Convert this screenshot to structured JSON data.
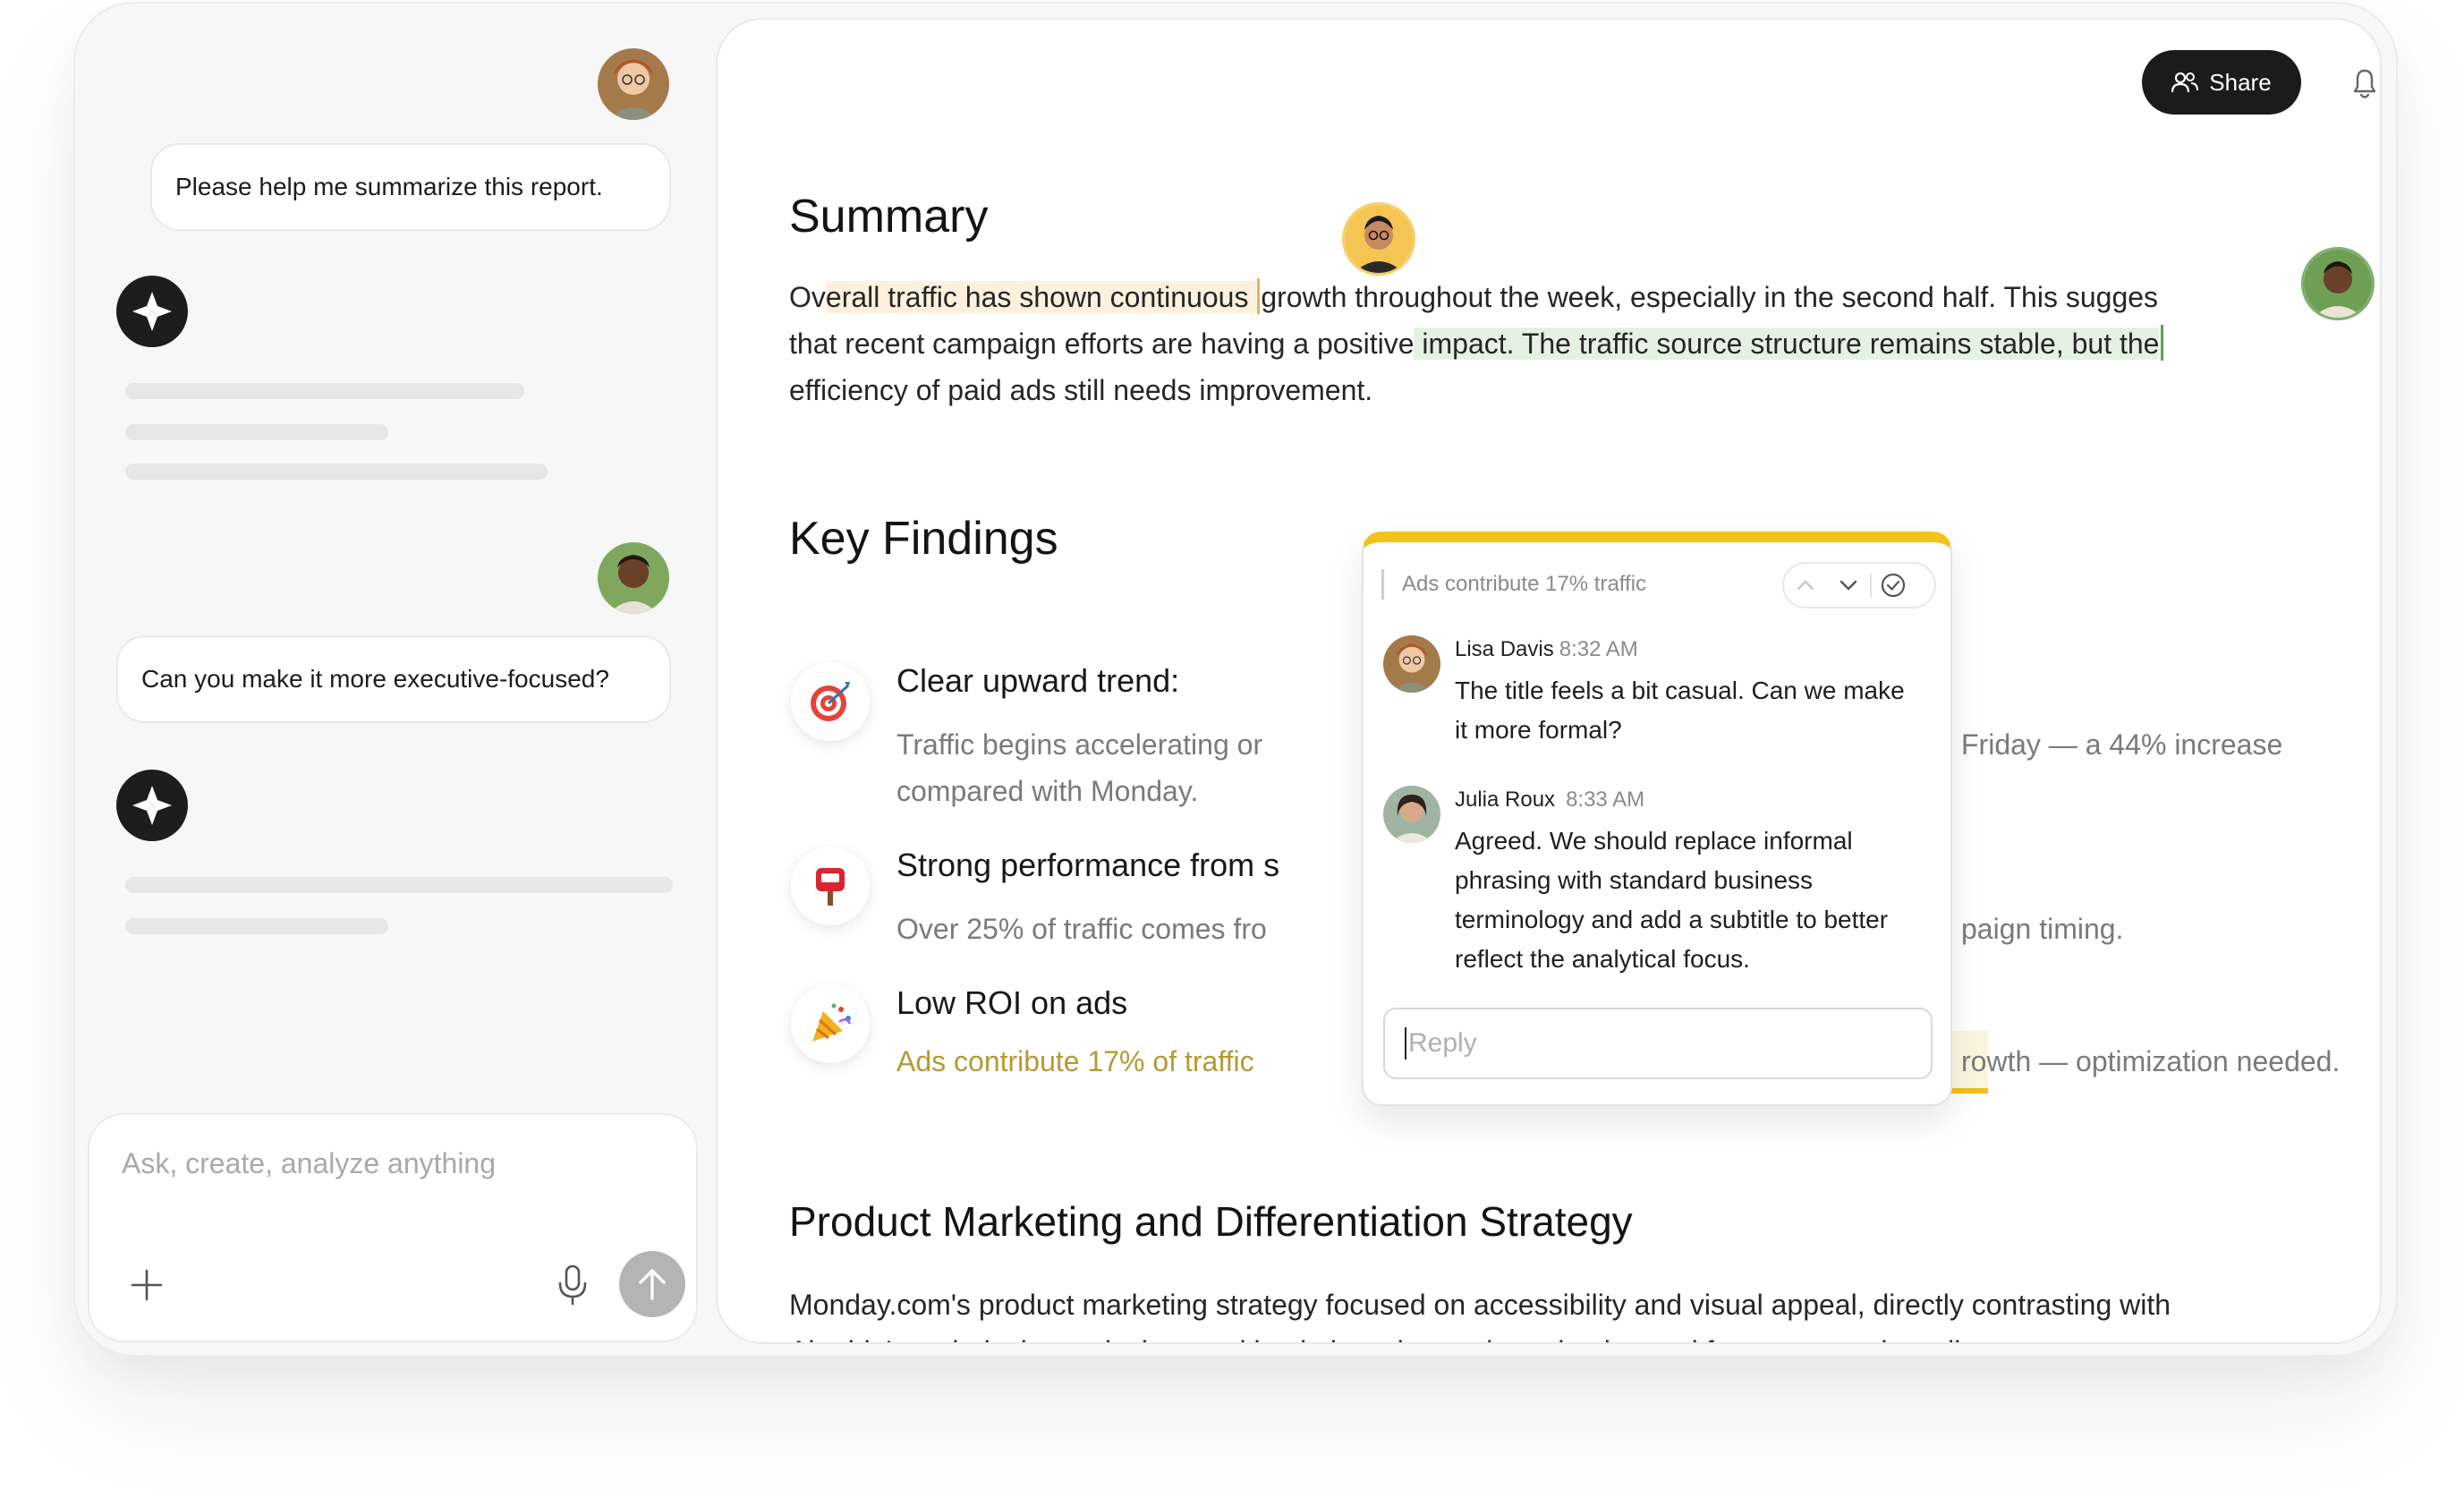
{
  "chat": {
    "messages": [
      {
        "role": "user",
        "text": "Please help me summarize this report."
      },
      {
        "role": "assistant",
        "text": ""
      },
      {
        "role": "user",
        "text": "Can you make it more executive-focused?"
      },
      {
        "role": "assistant",
        "text": ""
      }
    ],
    "composer": {
      "placeholder": "Ask, create, analyze anything"
    }
  },
  "header": {
    "share_label": "Share"
  },
  "summary": {
    "heading": "Summary",
    "p_plain_1": "Ov",
    "p_hl_y": "erall traffic has shown continuous ",
    "p_plain_2": "growth throughout the week, especially in the second half. This sugges",
    "p_plain_3": "that recent campaign efforts are having a positive",
    "p_hl_g": " impact. The traffic source structure remains stable, but the",
    "p_plain_4": "efficiency of paid ads still needs improvement."
  },
  "key_findings": {
    "heading": "Key Findings",
    "items": [
      {
        "icon": "target-icon",
        "title": "Clear upward trend:",
        "line1_left": "Traffic begins accelerating or",
        "line1_right": "Friday — a 44% increase",
        "line2": "compared with Monday."
      },
      {
        "icon": "mailbox-icon",
        "title": "Strong performance from s",
        "line1_left": "Over 25% of traffic comes fro",
        "line1_right": "paign timing."
      },
      {
        "icon": "party-popper-icon",
        "title": "Low ROI on ads",
        "line1_left": "Ads contribute 17% of traffic",
        "line1_right": "rowth — optimization needed."
      }
    ]
  },
  "comment_thread": {
    "quote": "Ads contribute 17% traffic",
    "comments": [
      {
        "author": "Lisa Davis",
        "time": "8:32 AM",
        "text": "The title feels a bit casual. Can we make it more formal?"
      },
      {
        "author": "Julia Roux",
        "time": "8:33 AM",
        "text": "Agreed. We should replace informal phrasing with standard business terminology and add a subtitle to better reflect the analytical focus."
      }
    ],
    "reply_placeholder": "Reply"
  },
  "product_section": {
    "heading": "Product Marketing and Differentiation Strategy",
    "line1": "Monday.com's product marketing strategy focused on accessibility and visual appeal, directly contrasting with",
    "line2": "Airtable's technical complexity, resulting in broader market adoption and faster user onboarding."
  },
  "colors": {
    "accent_yellow": "#f4c31a",
    "highlight_green": "#e5f2e3",
    "dark_button": "#1b1b1b"
  }
}
